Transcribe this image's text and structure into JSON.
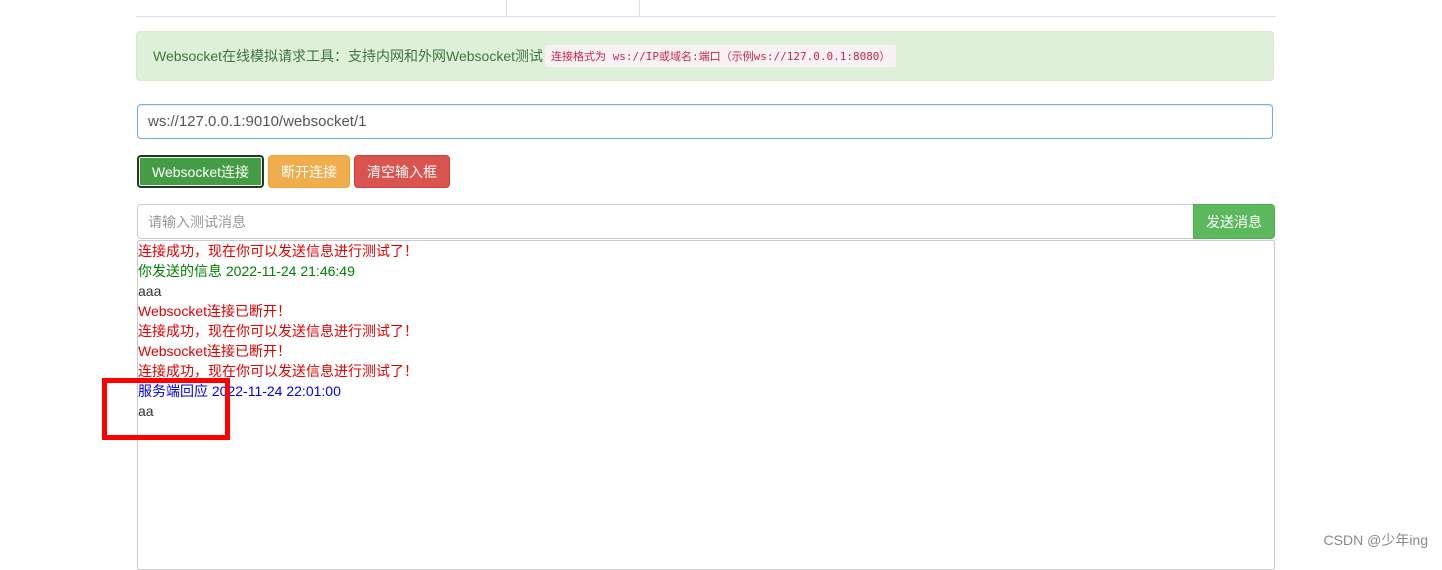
{
  "alert": {
    "text": "Websocket在线模拟请求工具：支持内网和外网Websocket测试",
    "format_label": "连接格式为",
    "format_code": "ws://IP或域名:端口（示例ws://127.0.0.1:8080）"
  },
  "url_input": {
    "value": "ws://127.0.0.1:9010/websocket/1"
  },
  "buttons": {
    "connect": "Websocket连接",
    "disconnect": "断开连接",
    "clear": "清空输入框",
    "send": "发送消息"
  },
  "message_input": {
    "placeholder": "请输入测试消息",
    "value": ""
  },
  "log": [
    {
      "text": "连接成功，现在你可以发送信息进行测试了！",
      "color": "red"
    },
    {
      "text": "你发送的信息 2022-11-24 21:46:49",
      "color": "green"
    },
    {
      "text": "aaa",
      "color": "plain"
    },
    {
      "text": "Websocket连接已断开！",
      "color": "red"
    },
    {
      "text": "连接成功，现在你可以发送信息进行测试了！",
      "color": "red"
    },
    {
      "text": "Websocket连接已断开！",
      "color": "red"
    },
    {
      "text": "连接成功，现在你可以发送信息进行测试了！",
      "color": "red"
    },
    {
      "text": "服务端回应 2022-11-24 22:01:00",
      "color": "blue"
    },
    {
      "text": "aa",
      "color": "plain"
    }
  ],
  "colors": {
    "red": "#e00000",
    "green": "#008000",
    "blue": "#0000ee",
    "highlight": "#ff0000"
  },
  "watermark": "CSDN @少年ing"
}
